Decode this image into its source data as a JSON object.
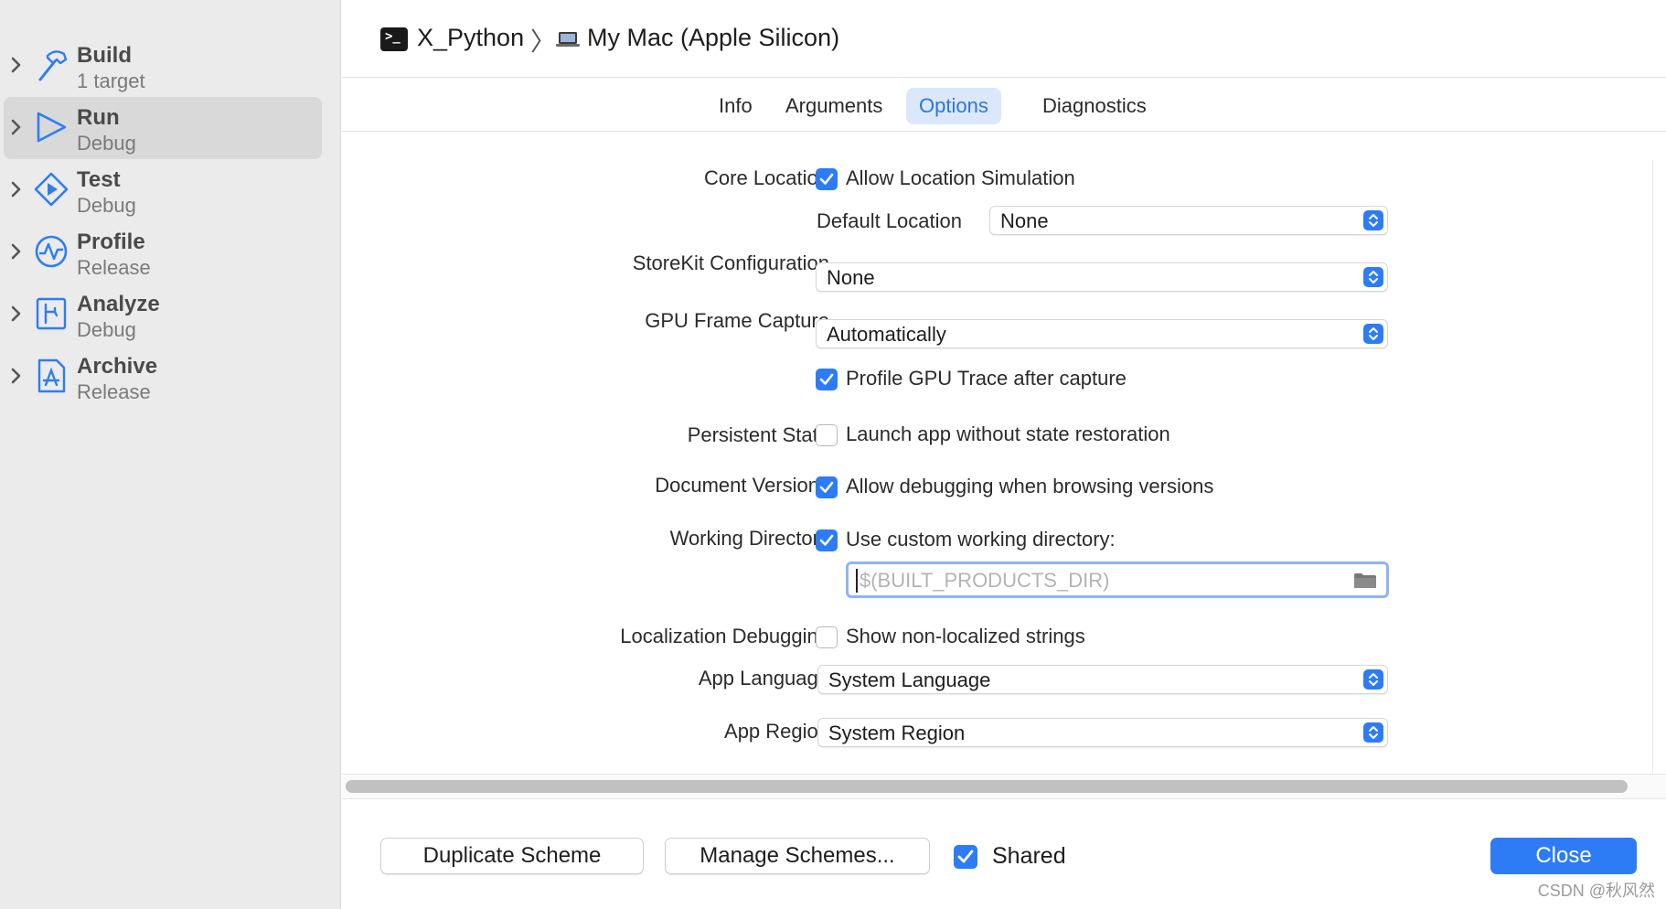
{
  "sidebar": {
    "actions": [
      {
        "name": "Build",
        "config": "1 target",
        "icon": "hammer-icon"
      },
      {
        "name": "Run",
        "config": "Debug",
        "icon": "play-icon",
        "selected": true
      },
      {
        "name": "Test",
        "config": "Debug",
        "icon": "test-diamond-icon"
      },
      {
        "name": "Profile",
        "config": "Release",
        "icon": "waveform-icon"
      },
      {
        "name": "Analyze",
        "config": "Debug",
        "icon": "analyze-icon"
      },
      {
        "name": "Archive",
        "config": "Release",
        "icon": "archive-app-icon"
      }
    ]
  },
  "header": {
    "scheme": "X_Python",
    "separator": "〉",
    "destination": "My Mac (Apple Silicon)"
  },
  "tabs": [
    {
      "label": "Info"
    },
    {
      "label": "Arguments"
    },
    {
      "label": "Options",
      "active": true
    },
    {
      "label": "Diagnostics"
    }
  ],
  "options": {
    "core_location": {
      "label": "Core Location",
      "allow_simulation": {
        "text": "Allow Location Simulation",
        "checked": true
      },
      "default_location_label": "Default Location",
      "default_location_value": "None"
    },
    "storekit": {
      "label": "StoreKit Configuration",
      "value": "None"
    },
    "gpu_frame_capture": {
      "label": "GPU Frame Capture",
      "value": "Automatically",
      "profile_trace": {
        "text": "Profile GPU Trace after capture",
        "checked": true
      }
    },
    "persistent_state": {
      "label": "Persistent State",
      "text": "Launch app without state restoration",
      "checked": false
    },
    "document_versions": {
      "label": "Document Versions",
      "text": "Allow debugging when browsing versions",
      "checked": true
    },
    "working_directory": {
      "label": "Working Directory",
      "text": "Use custom working directory:",
      "checked": true,
      "placeholder": "$(BUILT_PRODUCTS_DIR)"
    },
    "localization_debugging": {
      "label": "Localization Debugging",
      "text": "Show non-localized strings",
      "checked": false
    },
    "app_language": {
      "label": "App Language",
      "value": "System Language"
    },
    "app_region": {
      "label": "App Region",
      "value": "System Region"
    }
  },
  "footer": {
    "duplicate": "Duplicate Scheme",
    "manage": "Manage Schemes...",
    "shared_label": "Shared",
    "shared_checked": true,
    "close": "Close"
  },
  "watermark": "CSDN @秋风然",
  "colors": {
    "accent": "#2d7cf6",
    "sidebar_bg": "#ebebeb",
    "selected_bg": "#d9d9d9",
    "tab_active_bg": "#dbe8fb"
  }
}
